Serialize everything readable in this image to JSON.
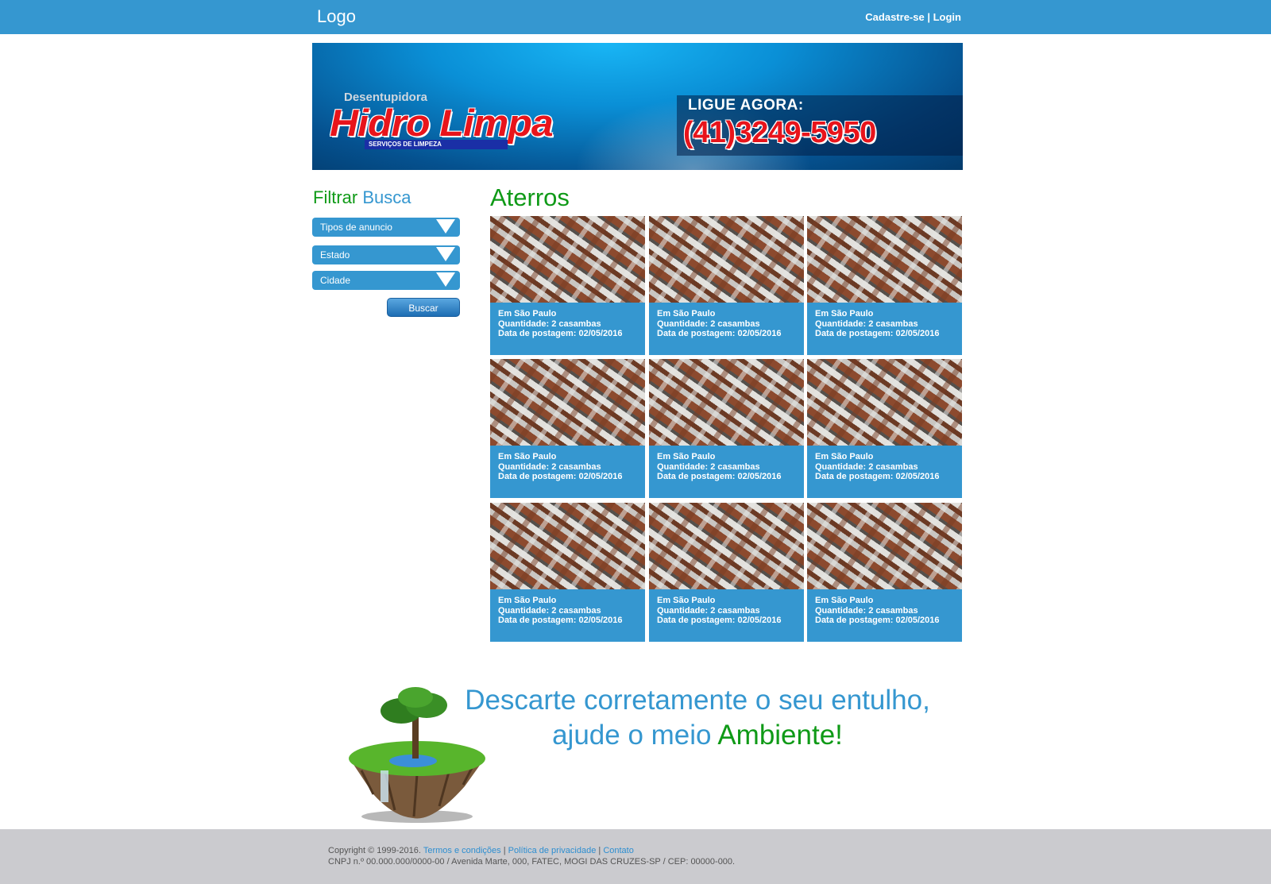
{
  "header": {
    "logo": "Logo",
    "signup": "Cadastre-se",
    "separator": "|",
    "login": "Login"
  },
  "banner": {
    "brand_top": "Desentupidora",
    "brand_name": "Hidro Limpa",
    "brand_sub": "SERVIÇOS DE LIMPEZA",
    "call_label": "LIGUE AGORA:",
    "phone": "(41)3249-5950"
  },
  "filter": {
    "title_part1": "Filtrar",
    "title_part2": "Busca",
    "selects": [
      {
        "label": "Tipos de anuncio"
      },
      {
        "label": "Estado"
      },
      {
        "label": "Cidade"
      }
    ],
    "search_button": "Buscar"
  },
  "main": {
    "title": "Aterros",
    "cards": [
      {
        "location": "Em São Paulo",
        "quantity": "Quantidade: 2 casambas",
        "date": "Data de postagem: 02/05/2016"
      },
      {
        "location": "Em São Paulo",
        "quantity": "Quantidade: 2 casambas",
        "date": "Data de postagem: 02/05/2016"
      },
      {
        "location": "Em São Paulo",
        "quantity": "Quantidade: 2 casambas",
        "date": "Data de postagem: 02/05/2016"
      },
      {
        "location": "Em São Paulo",
        "quantity": "Quantidade: 2 casambas",
        "date": "Data de postagem: 02/05/2016"
      },
      {
        "location": "Em São Paulo",
        "quantity": "Quantidade: 2 casambas",
        "date": "Data de postagem: 02/05/2016"
      },
      {
        "location": "Em São Paulo",
        "quantity": "Quantidade: 2 casambas",
        "date": "Data de postagem: 02/05/2016"
      },
      {
        "location": "Em São Paulo",
        "quantity": "Quantidade: 2 casambas",
        "date": "Data de postagem: 02/05/2016"
      },
      {
        "location": "Em São Paulo",
        "quantity": "Quantidade: 2 casambas",
        "date": "Data de postagem: 02/05/2016"
      },
      {
        "location": "Em São Paulo",
        "quantity": "Quantidade: 2 casambas",
        "date": "Data de postagem: 02/05/2016"
      }
    ]
  },
  "promo": {
    "line1": "Descarte corretamente o seu entulho,",
    "line2_part1": "ajude o meio",
    "line2_part2": "Ambiente!"
  },
  "footer": {
    "copyright": "Copyright © 1999-2016.",
    "terms": "Termos e condições",
    "privacy": "Política de privacidade",
    "contact": "Contato",
    "sep": "|",
    "address": "CNPJ n.º 00.000.000/0000-00 / Avenida Marte, 000, FATEC, MOGI DAS CRUZES-SP / CEP: 00000-000."
  },
  "colors": {
    "primary_blue": "#3597d0",
    "green": "#0f9a17",
    "footer_gray": "#cbcbcf"
  }
}
